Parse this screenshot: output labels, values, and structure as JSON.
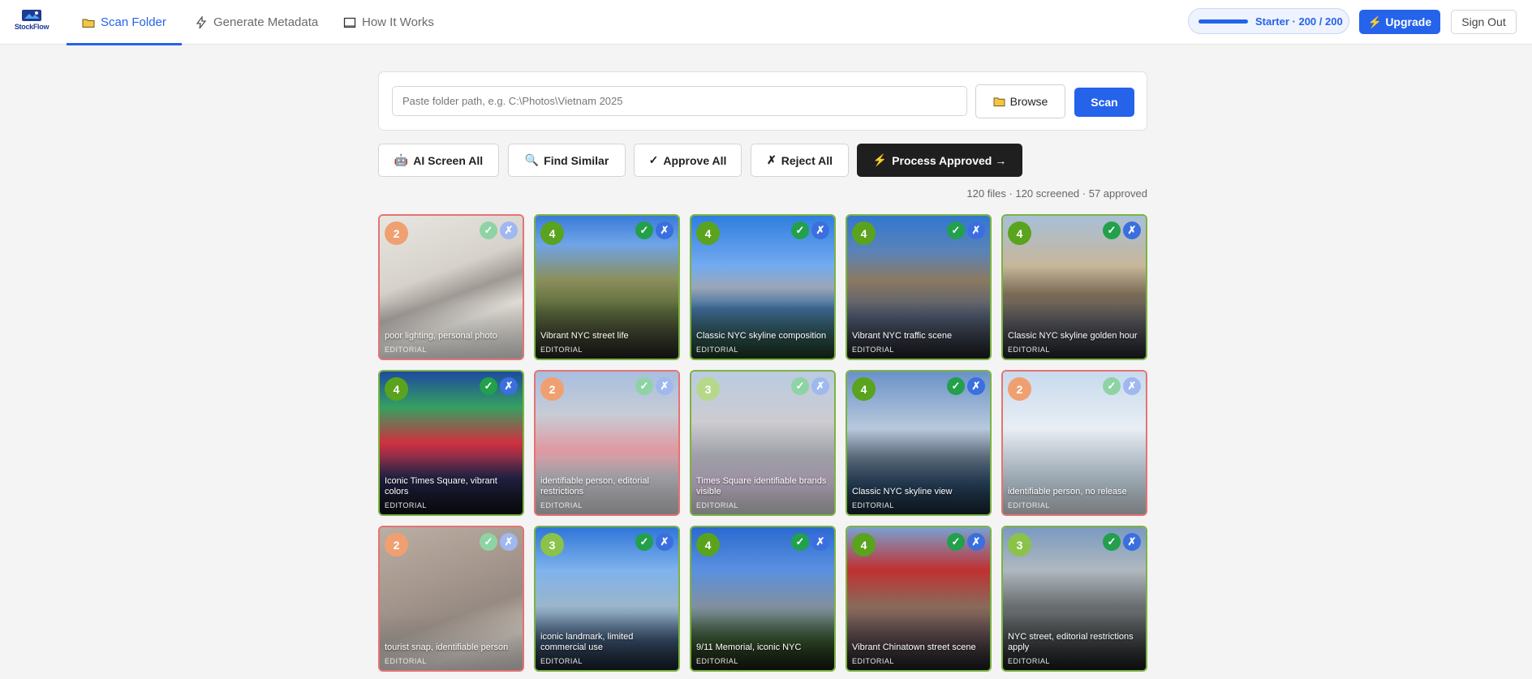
{
  "brand": {
    "name": "StockFlow"
  },
  "nav": {
    "tabs": [
      {
        "label": "Scan Folder",
        "icon": "folder-icon",
        "active": true
      },
      {
        "label": "Generate Metadata",
        "icon": "bolt-icon",
        "active": false
      },
      {
        "label": "How It Works",
        "icon": "book-icon",
        "active": false
      }
    ]
  },
  "account": {
    "plan_label": "Starter · 200 / 200",
    "usage_fraction": 1.0,
    "upgrade_label": "Upgrade",
    "signout_label": "Sign Out"
  },
  "scanner": {
    "path_placeholder": "Paste folder path, e.g. C:\\Photos\\Vietnam 2025",
    "path_value": "",
    "browse_label": "Browse",
    "scan_label": "Scan"
  },
  "actions": {
    "ai_screen": "AI Screen All",
    "find_similar": "Find Similar",
    "approve_all": "Approve All",
    "reject_all": "Reject All",
    "process_approved": "Process Approved →"
  },
  "summary": "120 files · 120 screened · 57 approved",
  "colors": {
    "accent": "#2563eb",
    "approved_border": "#7cb342",
    "rejected_border": "#e57373",
    "dark_button": "#1f1f1f"
  },
  "photos": [
    {
      "score": "2",
      "caption": "poor lighting, personal photo",
      "license": "EDITORIAL",
      "status": "rejected"
    },
    {
      "score": "4",
      "caption": "Vibrant NYC street life",
      "license": "EDITORIAL",
      "status": "approved"
    },
    {
      "score": "4",
      "caption": "Classic NYC skyline composition",
      "license": "EDITORIAL",
      "status": "approved"
    },
    {
      "score": "4",
      "caption": "Vibrant NYC traffic scene",
      "license": "EDITORIAL",
      "status": "approved"
    },
    {
      "score": "4",
      "caption": "Classic NYC skyline golden hour",
      "license": "EDITORIAL",
      "status": "approved"
    },
    {
      "score": "4",
      "caption": "Iconic Times Square, vibrant colors",
      "license": "EDITORIAL",
      "status": "approved"
    },
    {
      "score": "2",
      "caption": "identifiable person, editorial restrictions",
      "license": "EDITORIAL",
      "status": "rejected"
    },
    {
      "score": "3",
      "caption": "Times Square identifiable brands visible",
      "license": "EDITORIAL",
      "status": "approved-faded"
    },
    {
      "score": "4",
      "caption": "Classic NYC skyline view",
      "license": "EDITORIAL",
      "status": "approved"
    },
    {
      "score": "2",
      "caption": "identifiable person, no release",
      "license": "EDITORIAL",
      "status": "rejected"
    },
    {
      "score": "2",
      "caption": "tourist snap, identifiable person",
      "license": "EDITORIAL",
      "status": "rejected"
    },
    {
      "score": "3",
      "caption": "iconic landmark, limited commercial use",
      "license": "EDITORIAL",
      "status": "approved"
    },
    {
      "score": "4",
      "caption": "9/11 Memorial, iconic NYC",
      "license": "EDITORIAL",
      "status": "approved"
    },
    {
      "score": "4",
      "caption": "Vibrant Chinatown street scene",
      "license": "EDITORIAL",
      "status": "approved"
    },
    {
      "score": "3",
      "caption": "NYC street, editorial restrictions apply",
      "license": "EDITORIAL",
      "status": "approved"
    }
  ]
}
